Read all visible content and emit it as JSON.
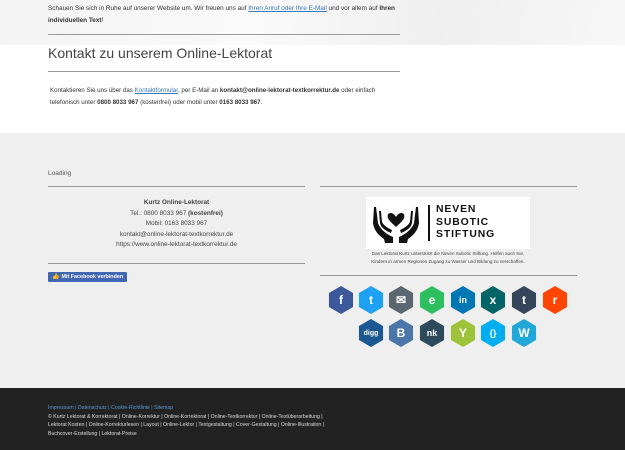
{
  "hero": {
    "line_pre": "Schauen Sie sich in Ruhe auf unserer Website um. Wir freuen uns auf ",
    "link": "Ihren Anruf oder Ihre E-Mail",
    "line_mid": " und vor allem auf ",
    "bold1": "Ihren",
    "bold2": "individuellen Text",
    "end": "!"
  },
  "contact": {
    "title": "Kontakt zu unserem Online-Lektorat",
    "p1": "Kontaktieren Sie uns über das ",
    "form_link": "Kontaktformular",
    "p2": ", per E-Mail an ",
    "email_bold": "kontakt@online-lektorat-textkorrektur.de",
    "p3": " oder einfach telefonisch unter ",
    "phone_bold": "0800 8033 967",
    "p4": " (kostenfrei) oder mobil unter ",
    "mobile_bold": "0163 8033 967",
    "p5": "."
  },
  "loading": "Loading",
  "company": {
    "name": "Kurtz Online-Lektorat",
    "tel_pre": "Tel.: 0800 8033 967 ",
    "tel_free": "(kostenfrei)",
    "mobile": "Mobil: 0163 8033 967",
    "email": "kontakt@online-lektorat-textkorrektur.de",
    "url": "https://www.online-lektorat-textkorrektur.de"
  },
  "facebook_button": "Mit Facebook verbinden",
  "neven": {
    "line1": "NEVEN",
    "line2": "SUBOTIC",
    "line3": "STIFTUNG",
    "caption": "Das Lektorat Kurtz unterstützt die Neven Subotic Stiftung. Helfen auch Sie, Kindern in armen Regionen Zugang zu Wasser und Bildung zu verschaffen."
  },
  "social": [
    {
      "name": "facebook-icon",
      "glyph": "f",
      "color": "#3b5998"
    },
    {
      "name": "twitter-icon",
      "glyph": "t",
      "color": "#1da1f2"
    },
    {
      "name": "email-icon",
      "glyph": "✉",
      "color": "#5b6770"
    },
    {
      "name": "evernote-icon",
      "glyph": "e",
      "color": "#2dbe60"
    },
    {
      "name": "linkedin-icon",
      "glyph": "in",
      "color": "#0077b5"
    },
    {
      "name": "xing-icon",
      "glyph": "x",
      "color": "#026466"
    },
    {
      "name": "tumblr-icon",
      "glyph": "t",
      "color": "#35465c"
    },
    {
      "name": "reddit-icon",
      "glyph": "r",
      "color": "#ff4500"
    },
    {
      "name": "digg-icon",
      "glyph": "digg",
      "color": "#1b5891"
    },
    {
      "name": "vk-icon",
      "glyph": "B",
      "color": "#4a76a8"
    },
    {
      "name": "newsvine-icon",
      "glyph": "nk",
      "color": "#2c4a5a"
    },
    {
      "name": "yummly-icon",
      "glyph": "Y",
      "color": "#9dc33b"
    },
    {
      "name": "delicious-icon",
      "glyph": "{}",
      "color": "#00aeef"
    },
    {
      "name": "wordpress-icon",
      "glyph": "W",
      "color": "#21a8d8"
    }
  ],
  "footer": {
    "links": "Impressum | Datenschutz | Cookie-Richtlinie | Sitemap",
    "body": "© Kurtz Lektorat & Korrektorat | Online-Korrektur | Online-Korrektorat | Online-Textkorrektur | Online-Textüberarbeitung | Lektorat Kosten | Online-Korrekturlesen | Layout | Online-Lektor | Textgestaltung | Cover-Gestaltung | Online-Illustration | Buchcover-Erstellung | Lektorat-Preise"
  }
}
